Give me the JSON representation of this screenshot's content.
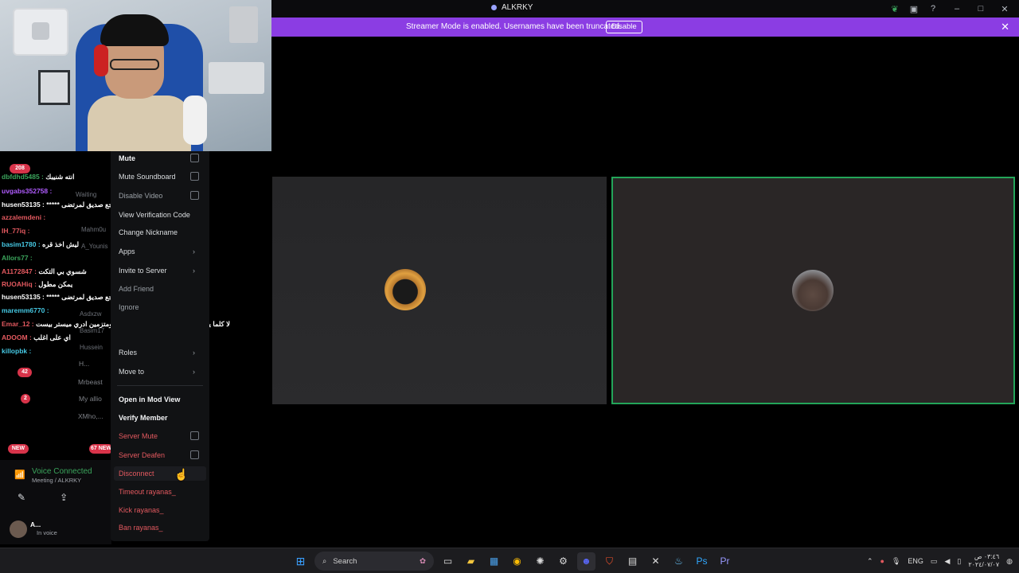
{
  "app": {
    "title": "ALKRKY"
  },
  "banner": {
    "text": "Streamer Mode is enabled. Usernames have been truncated.",
    "button": "Disable"
  },
  "titlebar_icons": [
    "leaf-icon",
    "inbox-icon",
    "help-icon",
    "minimize-icon",
    "maximize-icon",
    "close-icon"
  ],
  "chat": [
    {
      "name": "dbfdhd5485 :",
      "text": "انته شنيبك",
      "color": "#3ba55c"
    },
    {
      "name": "uvgabs352758 :",
      "text": "",
      "color": "#b15cff"
    },
    {
      "name": "husen53135 :",
      "text": "***** شوكت ترجع صديق لمرتضى",
      "color": "#ffffff"
    },
    {
      "name": "azzalemdeni :",
      "text": "",
      "color": "#e3595f"
    },
    {
      "name": "IH_77iq :",
      "text": "",
      "color": "#e3595f"
    },
    {
      "name": "basim1780 :",
      "text": "ليش اخذ قره",
      "color": "#46c9e4"
    },
    {
      "name": "Allors77 :",
      "text": "",
      "color": "#3ba55c"
    },
    {
      "name": "A1172847 :",
      "text": "شسوي بي التكت",
      "color": "#e3595f"
    },
    {
      "name": "RUOAHiq :",
      "text": "يمكن مطول",
      "color": "#e3595f"
    },
    {
      "name": "husen53135 :",
      "text": "***** شوكت ترجع صديق لمرتضى",
      "color": "#ffffff"
    },
    {
      "name": "maremm6770 :",
      "text": "",
      "color": "#46c9e4"
    },
    {
      "name": "Emar_12 :",
      "text": "لا كلما يصير تصويت الكلح كليلي منو الفايز ومتزمين ادري ميستر بيست",
      "color": "#e3595f"
    },
    {
      "name": "ADOOM :",
      "text": "اي على اغلب",
      "color": "#e3595f"
    },
    {
      "name": "killopbk :",
      "text": "",
      "color": "#46c9e4"
    }
  ],
  "left_badges": {
    "top": "208",
    "mid1": "42",
    "mid2": "2",
    "new": "NEW",
    "new_count": "67 NEW"
  },
  "members_dim": [
    "H...",
    "Mrbeast",
    "My allio",
    "XMho,...",
    "Hussein",
    "Basim17",
    "Asdxzw",
    "Waiting",
    "Mahm0u",
    "A_Younis"
  ],
  "voice": {
    "title": "Voice Connected",
    "sub": "Meeting / ALKRKY",
    "user": "A...",
    "status": "In voice"
  },
  "menu": {
    "mute": "Mute",
    "mute_soundboard": "Mute Soundboard",
    "disable_video": "Disable Video",
    "verification": "View Verification Code",
    "nickname": "Change Nickname",
    "apps": "Apps",
    "invite": "Invite to Server",
    "add_friend": "Add Friend",
    "ignore": "Ignore",
    "roles": "Roles",
    "move_to": "Move to",
    "mod_view": "Open in Mod View",
    "verify": "Verify Member",
    "server_mute": "Server Mute",
    "server_deafen": "Server Deafen",
    "disconnect": "Disconnect",
    "timeout": "Timeout rayanas_",
    "kick": "Kick rayanas_",
    "ban": "Ban rayanas_"
  },
  "taskbar": {
    "search": "Search",
    "lang": "ENG",
    "time": "٠٣:٤٦ ص",
    "date": "٢٠٢٤/٠٧/٠٧"
  },
  "colors": {
    "accent": "#8b3de3",
    "speaking": "#23a559",
    "danger": "#e3595f"
  }
}
